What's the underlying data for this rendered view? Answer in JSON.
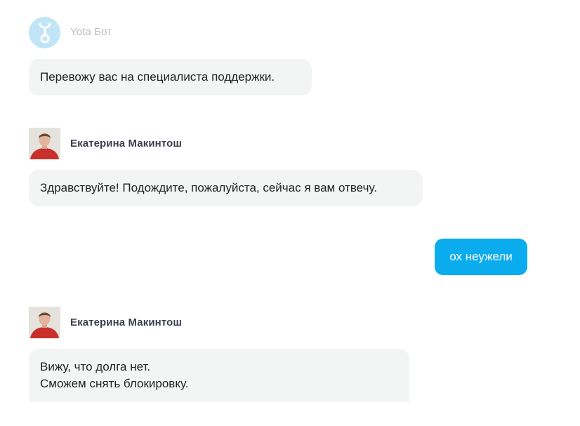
{
  "chat": {
    "messages": [
      {
        "sender": "Yota Бот",
        "text": "Перевожу вас на специалиста поддержки."
      },
      {
        "sender": "Екатерина Макинтош",
        "text": "Здравствуйте! Подождите, пожалуйста, сейчас я вам отвечу."
      },
      {
        "text": "ох неужели"
      },
      {
        "sender": "Екатерина Макинтош",
        "line1": "Вижу, что долга нет.",
        "line2": "Сможем снять блокировку."
      }
    ]
  },
  "colors": {
    "outgoing_bubble": "#0aaced",
    "incoming_bubble": "#f3f5f5",
    "bot_avatar": "#bfe5f7"
  },
  "icons": {
    "bot_avatar": "yota-logo-icon"
  }
}
